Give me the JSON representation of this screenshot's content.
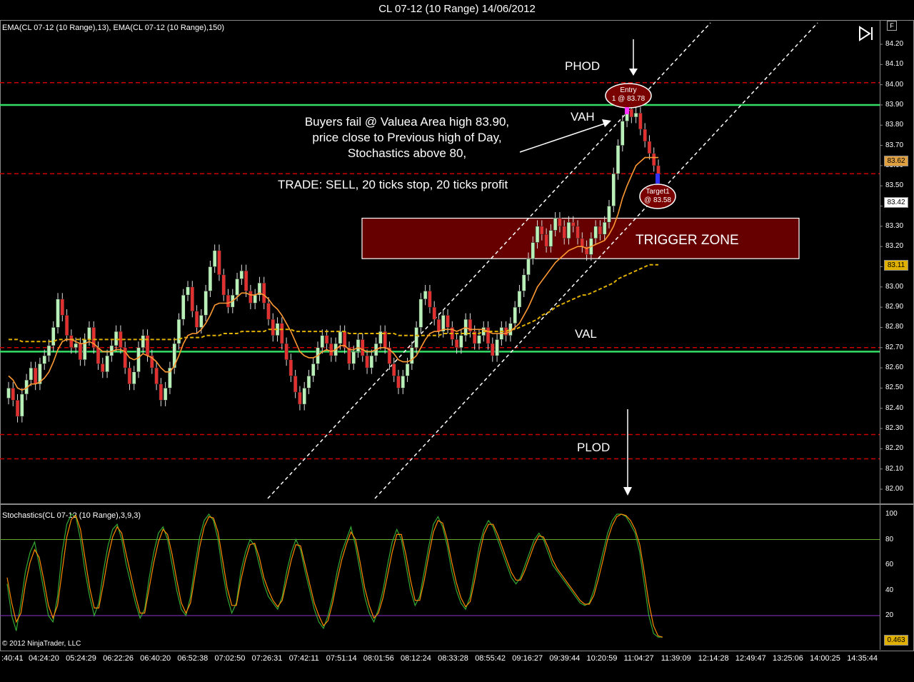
{
  "window": {
    "title": "CL 07-12 (10 Range)  14/06/2012"
  },
  "price_pane": {
    "indicator_label": "EMA(CL 07-12 (10 Range),13), EMA(CL 07-12 (10 Range),150)",
    "price_boxes": [
      {
        "value": "83.62",
        "bg": "#e0a040",
        "fg": "#000"
      },
      {
        "value": "83.42",
        "bg": "#ffffff",
        "fg": "#000"
      },
      {
        "value": "83.11",
        "bg": "#e0b000",
        "fg": "#000"
      }
    ]
  },
  "stoch_pane": {
    "indicator_label": "Stochastics(CL 07-12 (10 Range),3,9,3)",
    "value_box": "0.463"
  },
  "copyright": "© 2012 NinjaTrader, LLC",
  "annotations": {
    "phod": "PHOD",
    "vah": "VAH",
    "val": "VAL",
    "plod": "PLOD",
    "trigger_zone": "TRIGGER ZONE",
    "comment_line1": "Buyers fail @ Valuea Area high 83.90,",
    "comment_line2": "price close to Previous high of Day,",
    "comment_line3": "Stochastics above 80,",
    "trade": "TRADE: SELL, 20 ticks stop, 20 ticks profit",
    "entry_line1": "Entry",
    "entry_line2": "1 @ 83.78",
    "target_line1": "Target1",
    "target_line2": "@ 83.58"
  },
  "colors": {
    "up_candle": "#b8f0b8",
    "down_candle": "#e03030",
    "ema13": "#ff9933",
    "ema150": "#e0b000",
    "level_green": "#33dd66",
    "level_red": "#cc0000",
    "trigger_zone_bg": "#660000",
    "stoch_k": "#33aa33",
    "stoch_d": "#ff8800"
  },
  "chart_data": {
    "type": "candlestick",
    "title": "CL 07-12 (10 Range)  14/06/2012",
    "y_ticks": [
      "84.20",
      "84.10",
      "84.00",
      "83.90",
      "83.80",
      "83.70",
      "83.60",
      "83.50",
      "83.40",
      "83.30",
      "83.20",
      "83.10",
      "83.00",
      "82.90",
      "82.80",
      "82.70",
      "82.60",
      "82.50",
      "82.40",
      "82.30",
      "82.20",
      "82.10",
      "82.00"
    ],
    "ylim": [
      81.94,
      84.27
    ],
    "x_ticks": [
      ":40:41",
      "04:24:20",
      "05:24:29",
      "06:22:26",
      "06:40:20",
      "06:52:38",
      "07:02:50",
      "07:26:31",
      "07:42:11",
      "07:51:14",
      "08:01:56",
      "08:12:24",
      "08:33:28",
      "08:55:42",
      "09:16:27",
      "09:39:44",
      "10:20:59",
      "11:04:27",
      "11:39:09",
      "12:14:28",
      "12:49:47",
      "13:25:06",
      "14:00:25",
      "14:35:44"
    ],
    "levels": [
      {
        "name": "PHOD",
        "value": 84.01,
        "style": "dashed",
        "color": "red"
      },
      {
        "name": "VAH",
        "value": 83.9,
        "style": "solid",
        "color": "green"
      },
      {
        "name": "",
        "value": 83.56,
        "style": "dashed",
        "color": "red"
      },
      {
        "name": "VAL",
        "value": 82.7,
        "style": "dashed",
        "color": "red"
      },
      {
        "name": "",
        "value": 82.68,
        "style": "solid",
        "color": "green"
      },
      {
        "name": "",
        "value": 82.27,
        "style": "dashed",
        "color": "red"
      },
      {
        "name": "PLOD",
        "value": 82.15,
        "style": "dashed",
        "color": "red"
      }
    ],
    "trigger_zone": {
      "low": 83.14,
      "high": 83.34
    },
    "entry": {
      "price": 83.78
    },
    "target": {
      "price": 83.58
    },
    "closes": [
      82.5,
      82.44,
      82.36,
      82.47,
      82.54,
      82.6,
      82.52,
      82.62,
      82.66,
      82.71,
      82.8,
      82.94,
      82.86,
      82.76,
      82.7,
      82.72,
      82.64,
      82.74,
      82.8,
      82.7,
      82.62,
      82.58,
      82.66,
      82.71,
      82.78,
      82.7,
      82.6,
      82.52,
      82.58,
      82.7,
      82.76,
      82.66,
      82.6,
      82.52,
      82.44,
      82.5,
      82.6,
      82.72,
      82.84,
      82.96,
      83.0,
      82.88,
      82.8,
      82.86,
      82.98,
      83.1,
      83.18,
      83.06,
      82.96,
      82.9,
      82.96,
      83.04,
      83.08,
      82.98,
      82.92,
      82.96,
      83.02,
      82.92,
      82.84,
      82.76,
      82.82,
      82.72,
      82.64,
      82.56,
      82.48,
      82.42,
      82.5,
      82.56,
      82.62,
      82.7,
      82.76,
      82.72,
      82.66,
      82.72,
      82.78,
      82.7,
      82.62,
      82.68,
      82.74,
      82.66,
      82.6,
      82.66,
      82.72,
      82.78,
      82.7,
      82.62,
      82.56,
      82.5,
      82.56,
      82.62,
      82.7,
      82.8,
      82.94,
      82.98,
      82.9,
      82.84,
      82.78,
      82.86,
      82.8,
      82.74,
      82.7,
      82.76,
      82.84,
      82.78,
      82.72,
      82.76,
      82.8,
      82.72,
      82.66,
      82.74,
      82.8,
      82.76,
      82.82,
      82.9,
      82.98,
      83.06,
      83.14,
      83.22,
      83.3,
      83.26,
      83.2,
      83.28,
      83.34,
      83.3,
      83.24,
      83.32,
      83.3,
      83.24,
      83.2,
      83.16,
      83.24,
      83.3,
      83.26,
      83.32,
      83.4,
      83.56,
      83.7,
      83.82,
      83.88,
      83.84,
      83.86,
      83.78,
      83.72,
      83.66,
      83.6,
      83.56
    ],
    "ema13": [
      82.56,
      82.54,
      82.5,
      82.49,
      82.5,
      82.52,
      82.52,
      82.53,
      82.55,
      82.58,
      82.63,
      82.69,
      82.73,
      82.74,
      82.74,
      82.73,
      82.72,
      82.72,
      82.73,
      82.72,
      82.7,
      82.68,
      82.68,
      82.68,
      82.69,
      82.69,
      82.68,
      82.65,
      82.64,
      82.65,
      82.67,
      82.66,
      82.65,
      82.63,
      82.6,
      82.58,
      82.58,
      82.61,
      82.66,
      82.72,
      82.76,
      82.77,
      82.77,
      82.79,
      82.82,
      82.86,
      82.91,
      82.92,
      82.92,
      82.92,
      82.93,
      82.95,
      82.97,
      82.97,
      82.96,
      82.96,
      82.97,
      82.96,
      82.94,
      82.91,
      82.89,
      82.86,
      82.82,
      82.78,
      82.73,
      82.68,
      82.66,
      82.65,
      82.65,
      82.66,
      82.68,
      82.69,
      82.68,
      82.69,
      82.71,
      82.71,
      82.69,
      82.69,
      82.7,
      82.69,
      82.68,
      82.68,
      82.69,
      82.7,
      82.7,
      82.69,
      82.67,
      82.64,
      82.63,
      82.63,
      82.64,
      82.66,
      82.7,
      82.74,
      82.77,
      82.78,
      82.78,
      82.79,
      82.79,
      82.79,
      82.78,
      82.79,
      82.8,
      82.79,
      82.79,
      82.79,
      82.79,
      82.78,
      82.77,
      82.77,
      82.77,
      82.77,
      82.78,
      82.8,
      82.82,
      82.86,
      82.9,
      82.95,
      83.0,
      83.03,
      83.06,
      83.09,
      83.12,
      83.14,
      83.16,
      83.18,
      83.19,
      83.2,
      83.2,
      83.19,
      83.2,
      83.21,
      83.22,
      83.23,
      83.26,
      83.3,
      83.36,
      83.44,
      83.5,
      83.55,
      83.6,
      83.62,
      83.64,
      83.64,
      83.64,
      83.64
    ],
    "ema150": [
      82.74,
      82.74,
      82.74,
      82.73,
      82.73,
      82.73,
      82.73,
      82.73,
      82.73,
      82.73,
      82.73,
      82.74,
      82.74,
      82.74,
      82.74,
      82.74,
      82.74,
      82.74,
      82.74,
      82.74,
      82.74,
      82.74,
      82.74,
      82.74,
      82.74,
      82.74,
      82.74,
      82.74,
      82.74,
      82.74,
      82.74,
      82.74,
      82.74,
      82.74,
      82.74,
      82.74,
      82.74,
      82.74,
      82.74,
      82.75,
      82.75,
      82.75,
      82.75,
      82.75,
      82.76,
      82.76,
      82.76,
      82.76,
      82.77,
      82.77,
      82.77,
      82.77,
      82.78,
      82.78,
      82.78,
      82.78,
      82.78,
      82.78,
      82.79,
      82.79,
      82.79,
      82.79,
      82.79,
      82.79,
      82.78,
      82.78,
      82.78,
      82.78,
      82.78,
      82.78,
      82.78,
      82.78,
      82.78,
      82.78,
      82.78,
      82.78,
      82.77,
      82.77,
      82.77,
      82.77,
      82.77,
      82.77,
      82.77,
      82.77,
      82.77,
      82.77,
      82.77,
      82.76,
      82.76,
      82.76,
      82.76,
      82.76,
      82.76,
      82.76,
      82.76,
      82.76,
      82.76,
      82.77,
      82.77,
      82.77,
      82.77,
      82.77,
      82.77,
      82.77,
      82.77,
      82.77,
      82.78,
      82.78,
      82.78,
      82.78,
      82.78,
      82.78,
      82.79,
      82.79,
      82.8,
      82.81,
      82.82,
      82.83,
      82.84,
      82.86,
      82.87,
      82.88,
      82.9,
      82.91,
      82.92,
      82.93,
      82.94,
      82.95,
      82.96,
      82.96,
      82.97,
      82.98,
      82.99,
      83.0,
      83.01,
      83.02,
      83.04,
      83.05,
      83.06,
      83.07,
      83.08,
      83.09,
      83.1,
      83.11,
      83.11,
      83.11
    ],
    "stoch_ticks": [
      "100",
      "80",
      "60",
      "40",
      "20"
    ],
    "stoch_ylim": [
      -8,
      106
    ],
    "stoch_k": [
      45,
      20,
      8,
      30,
      55,
      70,
      78,
      60,
      40,
      20,
      15,
      35,
      70,
      92,
      100,
      98,
      80,
      55,
      35,
      20,
      30,
      55,
      75,
      88,
      92,
      80,
      60,
      45,
      30,
      18,
      25,
      50,
      70,
      85,
      90,
      80,
      60,
      40,
      25,
      20,
      35,
      60,
      82,
      95,
      100,
      95,
      80,
      55,
      35,
      22,
      30,
      55,
      70,
      80,
      75,
      60,
      45,
      35,
      30,
      25,
      35,
      55,
      70,
      80,
      72,
      55,
      40,
      25,
      15,
      10,
      20,
      35,
      55,
      70,
      80,
      90,
      75,
      55,
      35,
      22,
      15,
      25,
      40,
      60,
      78,
      88,
      80,
      60,
      40,
      28,
      35,
      55,
      75,
      92,
      98,
      90,
      75,
      55,
      40,
      30,
      25,
      35,
      55,
      75,
      88,
      95,
      90,
      80,
      70,
      60,
      50,
      45,
      50,
      60,
      70,
      80,
      85,
      80,
      70,
      60,
      55,
      50,
      45,
      40,
      35,
      30,
      28,
      30,
      40,
      55,
      70,
      85,
      95,
      100,
      100,
      98,
      92,
      85,
      70,
      45,
      20,
      6,
      3,
      3
    ],
    "stoch_d": [
      50,
      30,
      15,
      22,
      45,
      62,
      72,
      66,
      48,
      28,
      18,
      28,
      55,
      82,
      96,
      99,
      88,
      65,
      42,
      26,
      26,
      45,
      66,
      82,
      90,
      85,
      68,
      52,
      36,
      22,
      22,
      42,
      62,
      78,
      88,
      84,
      68,
      48,
      30,
      22,
      30,
      52,
      74,
      90,
      98,
      97,
      86,
      64,
      42,
      28,
      28,
      48,
      64,
      76,
      77,
      66,
      50,
      40,
      32,
      27,
      32,
      48,
      64,
      76,
      75,
      60,
      45,
      30,
      20,
      12,
      16,
      30,
      48,
      64,
      76,
      86,
      80,
      62,
      42,
      28,
      18,
      22,
      34,
      52,
      70,
      84,
      84,
      68,
      48,
      32,
      32,
      48,
      68,
      86,
      95,
      93,
      80,
      62,
      46,
      34,
      27,
      31,
      48,
      68,
      84,
      92,
      92,
      84,
      74,
      64,
      54,
      48,
      48,
      56,
      66,
      76,
      83,
      82,
      74,
      64,
      57,
      52,
      47,
      42,
      37,
      32,
      29,
      29,
      36,
      49,
      64,
      80,
      91,
      98,
      100,
      99,
      95,
      88,
      76,
      54,
      30,
      12,
      4,
      3
    ]
  }
}
